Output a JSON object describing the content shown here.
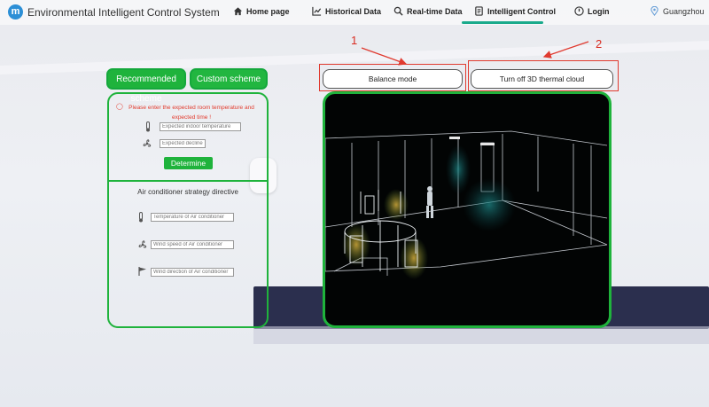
{
  "app": {
    "title": "Environmental Intelligent Control System",
    "logo_letter": "m"
  },
  "nav": {
    "items": [
      {
        "label": "Home page",
        "icon": "home-icon"
      },
      {
        "label": "Historical Data",
        "icon": "chart-icon"
      },
      {
        "label": "Real-time Data",
        "icon": "search-icon"
      },
      {
        "label": "Intelligent Control",
        "icon": "document-icon",
        "active": true
      },
      {
        "label": "Login",
        "icon": "power-icon"
      }
    ],
    "location": {
      "label": "Guangzhou",
      "icon": "location-pin-icon"
    }
  },
  "tabs": {
    "recommended": "Recommended scheme",
    "custom": "Custom scheme"
  },
  "form": {
    "warning": "Please enter the expected room temperature and expected time !",
    "temperature_placeholder": "Expected indoor temperature",
    "decline_placeholder": "Expected decline in time",
    "determine_label": "Determine"
  },
  "strategy": {
    "title": "Air conditioner strategy directive",
    "temperature_placeholder": "Temperature of Air conditioner",
    "wind_speed_placeholder": "Wind speed of Air conditioner",
    "wind_direction_placeholder": "Wind direction of Air conditioner"
  },
  "controls": {
    "balance_mode": "Balance mode",
    "thermal_cloud": "Turn off 3D thermal cloud"
  },
  "callouts": [
    "1",
    "2"
  ],
  "colors": {
    "accent": "#1fb33c",
    "callout": "#e03a2f",
    "nav_active": "#1aaa8c"
  }
}
